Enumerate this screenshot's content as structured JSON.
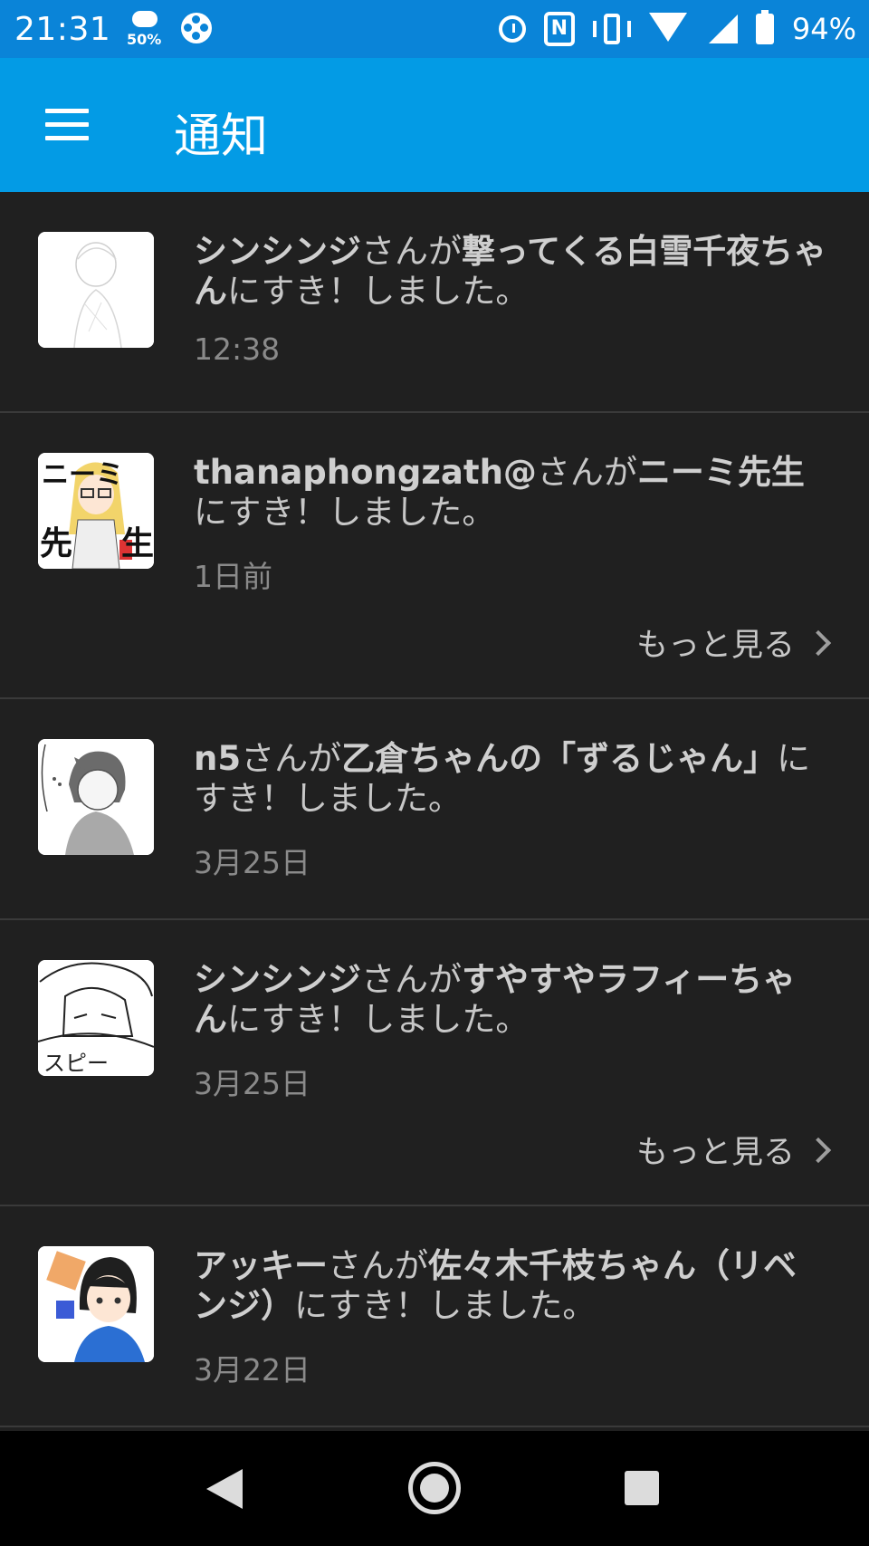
{
  "status_bar": {
    "time": "21:31",
    "weather_percent": "50%",
    "battery": "94%"
  },
  "app_bar": {
    "title": "通知"
  },
  "notifications": [
    {
      "user": "シンシンジ",
      "mid": "さんが",
      "work": "撃ってくる白雪千夜ちゃん",
      "tail": "にすき！しました。",
      "time": "12:38"
    },
    {
      "user": "thanaphongzath@",
      "mid": "さんが",
      "work": "ニーミ先生",
      "tail": "にすき！しました。",
      "time": "1日前",
      "more": "もっと見る"
    },
    {
      "user": "n5",
      "mid": "さんが",
      "work": "乙倉ちゃんの「ずるじゃん」",
      "tail": "にすき！しました。",
      "time": "3月25日"
    },
    {
      "user": "シンシンジ",
      "mid": "さんが",
      "work": "すやすやラフィーちゃん",
      "tail": "にすき！しました。",
      "time": "3月25日",
      "more": "もっと見る"
    },
    {
      "user": "アッキー",
      "mid": "さんが",
      "work": "佐々木千枝ちゃん（リベンジ）",
      "tail": "にすき！しました。",
      "time": "3月22日"
    }
  ],
  "thumb_texts": {
    "nimi_top": "ニーミ",
    "nimi_bottom_left": "先",
    "nimi_bottom_right": "生",
    "sleep": "スピー"
  },
  "colors": {
    "status_bar": "#0a84d8",
    "app_bar": "#039be5",
    "background": "#202020",
    "divider": "#3a3a3a"
  }
}
